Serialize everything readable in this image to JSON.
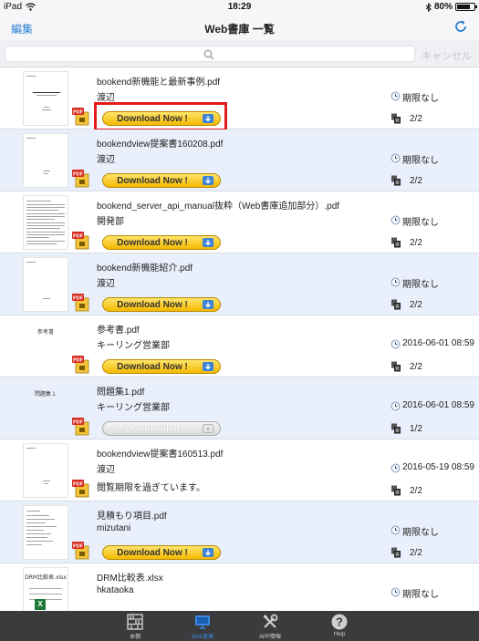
{
  "status_bar": {
    "device": "iPad",
    "time": "18:29",
    "battery": "80%",
    "battery_level": 0.8
  },
  "nav": {
    "edit_label": "編集",
    "title": "Web書庫 一覧"
  },
  "search": {
    "placeholder": "",
    "cancel_label": "キャンセル"
  },
  "download_label": "Download Now !",
  "downloaded_label": "Downloaded",
  "documents": [
    {
      "name": "bookend新機能と最新事例.pdf",
      "owner": "渡辺",
      "expiry": "期限なし",
      "count": "2/2",
      "note": "",
      "button": "download"
    },
    {
      "name": "bookendview提案書160208.pdf",
      "owner": "渡辺",
      "expiry": "期限なし",
      "count": "2/2",
      "note": "",
      "button": "download"
    },
    {
      "name": "bookend_server_api_manual抜粋（Web書庫追加部分）.pdf",
      "owner": "開発部",
      "expiry": "期限なし",
      "count": "2/2",
      "note": "",
      "button": "download"
    },
    {
      "name": "bookend新機能紹介.pdf",
      "owner": "渡辺",
      "expiry": "期限なし",
      "count": "2/2",
      "note": "",
      "button": "download"
    },
    {
      "name": "参考書.pdf",
      "owner": "キーリング営業部",
      "expiry": "2016-06-01 08:59",
      "count": "2/2",
      "note": "",
      "button": "download",
      "thumb_text": "参考書"
    },
    {
      "name": "問題集1.pdf",
      "owner": "キーリング営業部",
      "expiry": "2016-06-01 08:59",
      "count": "1/2",
      "note": "",
      "button": "downloaded",
      "thumb_text": "問題集１"
    },
    {
      "name": "bookendview提案書160513.pdf",
      "owner": "渡辺",
      "expiry": "2016-05-19 08:59",
      "count": "2/2",
      "note": "閲覧期限を過ぎています。",
      "button": "none"
    },
    {
      "name": "見積もり項目.pdf",
      "owner": "mizutani",
      "expiry": "期限なし",
      "count": "2/2",
      "note": "",
      "button": "download"
    },
    {
      "name": "DRM比較表.xlsx",
      "owner": "hkataoka",
      "expiry": "期限なし",
      "count": "",
      "note": "",
      "button": "none",
      "thumb_text": "DRM比較表.xlsx"
    }
  ],
  "tabs": [
    {
      "label": "本棚",
      "icon": "bookshelf-icon",
      "active": false
    },
    {
      "label": "Web書庫",
      "icon": "web-library-icon",
      "active": true
    },
    {
      "label": "APP情報",
      "icon": "tools-icon",
      "active": false
    },
    {
      "label": "Help",
      "icon": "help-icon",
      "active": false
    }
  ],
  "colors": {
    "accent": "#2a7fd4",
    "row_alt": "#eaf0fb",
    "download_button": "#f5b900",
    "highlight": "#e31b1b",
    "tab_bar": "#3b3b3d"
  }
}
